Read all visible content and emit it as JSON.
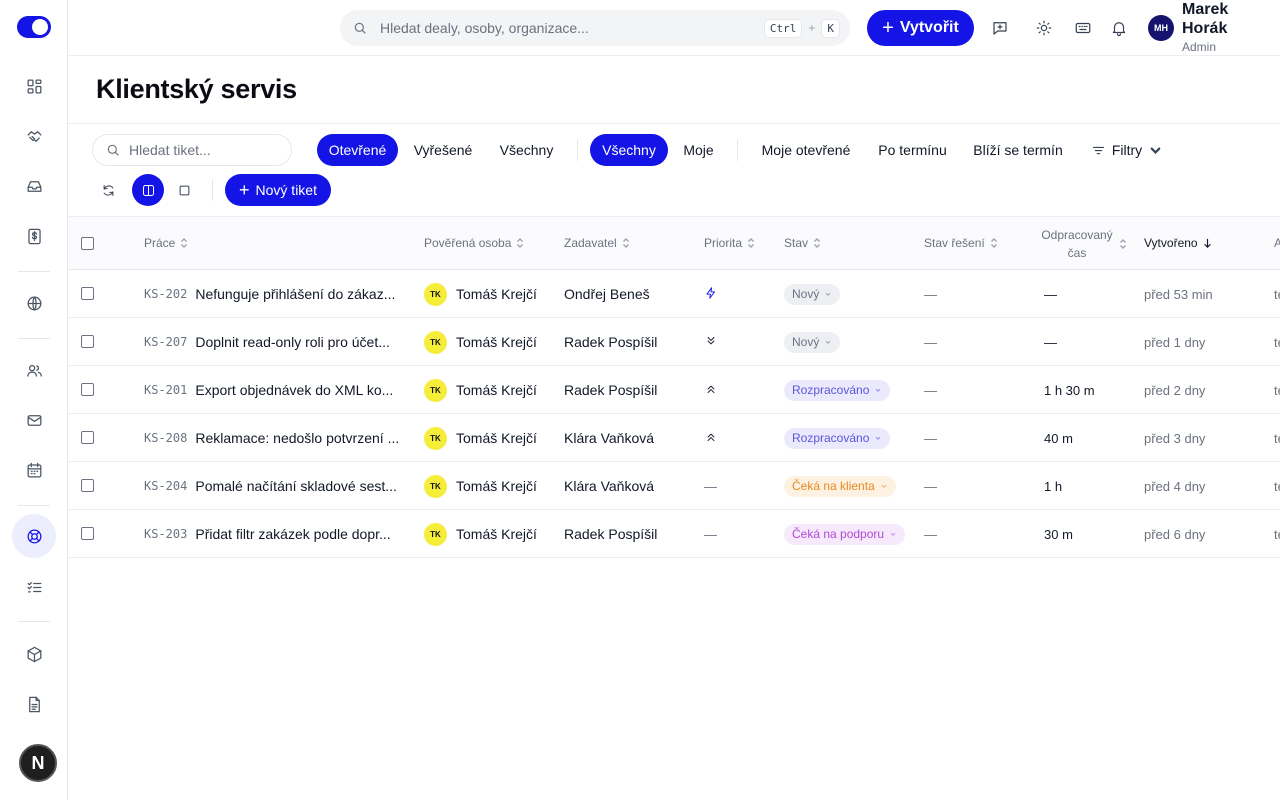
{
  "header": {
    "search_placeholder": "Hledat dealy, osoby, organizace...",
    "shortcut_key1": "Ctrl",
    "shortcut_plus": "+",
    "shortcut_key2": "K",
    "create_label": "Vytvořit",
    "user": {
      "initials": "MH",
      "name": "Marek Horák",
      "role": "Admin"
    }
  },
  "sidebar": {
    "icons": [
      "dashboard-icon",
      "handshake-icon",
      "inbox-icon",
      "dollar-icon",
      "globe-icon",
      "users-icon",
      "mail-icon",
      "calendar-icon",
      "support-icon",
      "checklist-icon",
      "box-icon",
      "document-icon"
    ],
    "active": "support-icon",
    "bottom_badge": "N"
  },
  "page": {
    "title": "Klientský servis"
  },
  "toolbar": {
    "search_placeholder": "Hledat tiket...",
    "status_tabs": [
      "Otevřené",
      "Vyřešené",
      "Všechny"
    ],
    "status_active": "Otevřené",
    "owner_tabs": [
      "Všechny",
      "Moje"
    ],
    "owner_active": "Všechny",
    "quick_filters": [
      "Moje otevřené",
      "Po termínu",
      "Blíží se termín"
    ],
    "filters_label": "Filtry",
    "new_ticket_label": "Nový tiket",
    "accent": "#1414e6"
  },
  "table": {
    "columns": [
      "Práce",
      "Pověřená osoba",
      "Zadavatel",
      "Priorita",
      "Stav",
      "Stav řešení",
      "Odpracovaný čas",
      "Vytvořeno",
      "A"
    ],
    "sorted_column": "Vytvořeno",
    "sort_direction": "desc",
    "rows": [
      {
        "id": "KS-202",
        "title": "Nefunguje přihlášení do zákaz...",
        "assignee_initials": "TK",
        "assignee": "Tomáš Krejčí",
        "requester": "Ondřej Beneš",
        "priority": "urgent",
        "status": "Nový",
        "status_color": "gray",
        "resolution": "—",
        "time": "—",
        "created": "před 53 min",
        "extra": "te"
      },
      {
        "id": "KS-207",
        "title": "Doplnit read-only roli pro účet...",
        "assignee_initials": "TK",
        "assignee": "Tomáš Krejčí",
        "requester": "Radek Pospíšil",
        "priority": "low",
        "status": "Nový",
        "status_color": "gray",
        "resolution": "—",
        "time": "—",
        "created": "před 1 dny",
        "extra": "te"
      },
      {
        "id": "KS-201",
        "title": "Export objednávek do XML ko...",
        "assignee_initials": "TK",
        "assignee": "Tomáš Krejčí",
        "requester": "Radek Pospíšil",
        "priority": "high",
        "status": "Rozpracováno",
        "status_color": "violet",
        "resolution": "—",
        "time": "1 h 30 m",
        "created": "před 2 dny",
        "extra": "te"
      },
      {
        "id": "KS-208",
        "title": "Reklamace: nedošlo potvrzení ...",
        "assignee_initials": "TK",
        "assignee": "Tomáš Krejčí",
        "requester": "Klára Vaňková",
        "priority": "high",
        "status": "Rozpracováno",
        "status_color": "violet",
        "resolution": "—",
        "time": "40 m",
        "created": "před 3 dny",
        "extra": "te"
      },
      {
        "id": "KS-204",
        "title": "Pomalé načítání skladové sest...",
        "assignee_initials": "TK",
        "assignee": "Tomáš Krejčí",
        "requester": "Klára Vaňková",
        "priority_text": "—",
        "status": "Čeká na klienta",
        "status_color": "orange",
        "resolution": "—",
        "time": "1 h",
        "created": "před 4 dny",
        "extra": "te"
      },
      {
        "id": "KS-203",
        "title": "Přidat filtr zakázek podle dopr...",
        "assignee_initials": "TK",
        "assignee": "Tomáš Krejčí",
        "requester": "Radek Pospíšil",
        "priority_text": "—",
        "status": "Čeká na podporu",
        "status_color": "purple",
        "resolution": "—",
        "time": "30 m",
        "created": "před 6 dny",
        "extra": "te"
      }
    ]
  }
}
